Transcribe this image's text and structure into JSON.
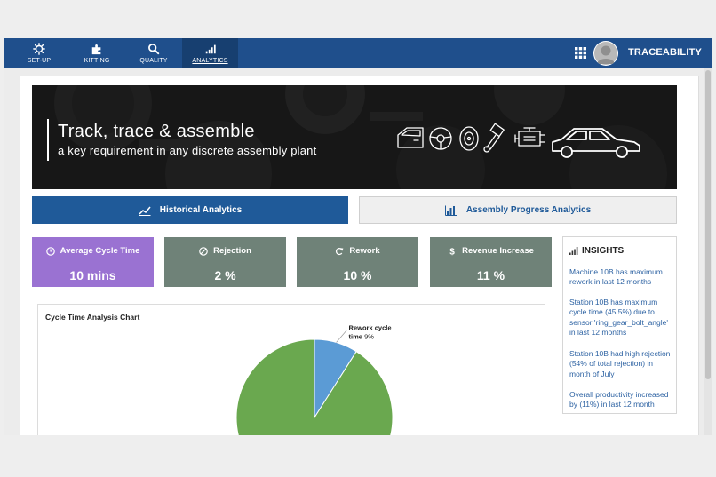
{
  "nav": {
    "items": [
      {
        "label": "SET-UP",
        "icon": "gear-icon"
      },
      {
        "label": "KITTING",
        "icon": "puzzle-icon"
      },
      {
        "label": "QUALITY",
        "icon": "search-icon"
      },
      {
        "label": "ANALYTICS",
        "icon": "bar-chart-icon",
        "active": true
      }
    ],
    "brand": "TRACEABILITY"
  },
  "hero": {
    "title": "Track, trace & assemble",
    "subtitle": "a key requirement in any discrete assembly plant",
    "icons": [
      "car-door-icon",
      "steering-wheel-icon",
      "tire-icon",
      "piston-icon",
      "engine-icon",
      "car-icon"
    ]
  },
  "tabs": [
    {
      "label": "Historical Analytics",
      "icon": "line-chart-icon",
      "active": true
    },
    {
      "label": "Assembly Progress Analytics",
      "icon": "bar-chart-icon",
      "active": false
    }
  ],
  "kpis": [
    {
      "label": "Average Cycle Time",
      "value": "10 mins",
      "icon": "clock-icon",
      "color": "#9a72d2"
    },
    {
      "label": "Rejection",
      "value": "2 %",
      "icon": "ban-icon",
      "color": "#6f8278"
    },
    {
      "label": "Rework",
      "value": "10 %",
      "icon": "refresh-icon",
      "color": "#6f8278"
    },
    {
      "label": "Revenue Increase",
      "value": "11 %",
      "icon": "dollar-icon",
      "color": "#6f8278"
    }
  ],
  "insights": {
    "title": "INSIGHTS",
    "items": [
      "Machine 10B has maximum rework in last 12 months",
      "Station 10B has maximum cycle time (45.5%) due to sensor 'ring_gear_bolt_angle' in last 12 months",
      "Station 10B  had high rejection (54% of total rejection) in month of July",
      "Overall productivity increased by (11%) in last 12 month"
    ]
  },
  "chart": {
    "title": "Cycle Time Analysis Chart"
  },
  "chart_data": {
    "type": "pie",
    "title": "Cycle Time Analysis Chart",
    "slices": [
      {
        "label": "Rework cycle time",
        "value": 9,
        "color": "#5b9bd5"
      },
      {
        "label": "",
        "value": 91,
        "color": "#6aa84f"
      }
    ]
  }
}
